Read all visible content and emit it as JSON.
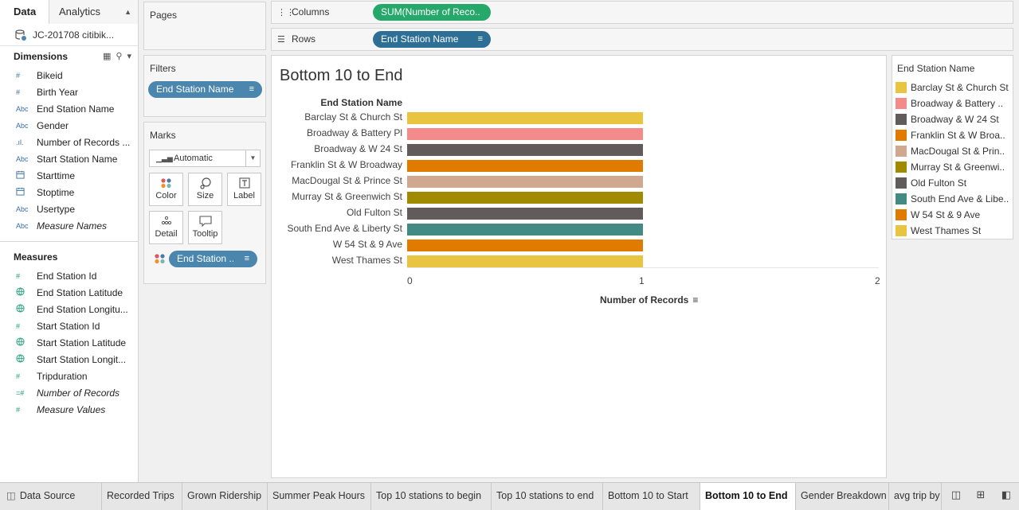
{
  "data_pane": {
    "tabs": {
      "data": "Data",
      "analytics": "Analytics"
    },
    "data_source": "JC-201708 citibik...",
    "dimensions_header": "Dimensions",
    "dimensions": [
      {
        "icon": "#",
        "name": "Bikeid"
      },
      {
        "icon": "#",
        "name": "Birth Year"
      },
      {
        "icon": "Abc",
        "name": "End Station Name"
      },
      {
        "icon": "Abc",
        "name": "Gender"
      },
      {
        "icon": ".ıl.",
        "name": "Number of Records ..."
      },
      {
        "icon": "Abc",
        "name": "Start Station Name"
      },
      {
        "icon": "cal",
        "name": "Starttime"
      },
      {
        "icon": "cal",
        "name": "Stoptime"
      },
      {
        "icon": "Abc",
        "name": "Usertype"
      },
      {
        "icon": "Abc",
        "name": "Measure Names",
        "italic": true
      }
    ],
    "measures_header": "Measures",
    "measures": [
      {
        "icon": "#",
        "name": "End Station Id"
      },
      {
        "icon": "globe",
        "name": "End Station Latitude"
      },
      {
        "icon": "globe",
        "name": "End Station Longitu..."
      },
      {
        "icon": "#",
        "name": "Start Station Id"
      },
      {
        "icon": "globe",
        "name": "Start Station Latitude"
      },
      {
        "icon": "globe",
        "name": "Start Station Longit..."
      },
      {
        "icon": "#",
        "name": "Tripduration"
      },
      {
        "icon": "=#",
        "name": "Number of Records",
        "italic": true
      },
      {
        "icon": "#",
        "name": "Measure Values",
        "italic": true
      }
    ]
  },
  "cards": {
    "pages": "Pages",
    "filters": "Filters",
    "filter_pill": "End Station Name",
    "marks": "Marks",
    "mark_type": "Automatic",
    "mark_buttons": {
      "color": "Color",
      "size": "Size",
      "label": "Label",
      "detail": "Detail",
      "tooltip": "Tooltip"
    },
    "color_pill": "End Station .."
  },
  "shelves": {
    "columns_label": "Columns",
    "columns_pill": "SUM(Number of Reco..",
    "rows_label": "Rows",
    "rows_pill": "End Station Name"
  },
  "view": {
    "title": "Bottom 10 to End"
  },
  "chart_data": {
    "type": "bar",
    "orientation": "horizontal",
    "title": "Bottom 10 to End",
    "ylabel": "End Station Name",
    "xlabel": "Number of Records",
    "categories": [
      "Barclay St & Church St",
      "Broadway & Battery Pl",
      "Broadway & W 24 St",
      "Franklin St & W Broadway",
      "MacDougal St & Prince St",
      "Murray St & Greenwich St",
      "Old Fulton St",
      "South End Ave & Liberty St",
      "W 54 St & 9 Ave",
      "West Thames St"
    ],
    "values": [
      1,
      1,
      1,
      1,
      1,
      1,
      1,
      1,
      1,
      1
    ],
    "colors": [
      "#e9c440",
      "#f28b89",
      "#625b5b",
      "#e07b00",
      "#cfa88f",
      "#a08b00",
      "#625b5b",
      "#438a85",
      "#e07b00",
      "#e9c440"
    ],
    "xlim": [
      0,
      2
    ],
    "xticks": [
      "0",
      "1",
      "2"
    ],
    "grid": false
  },
  "legend": {
    "title": "End Station Name",
    "items": [
      {
        "label": "Barclay St & Church St",
        "color": "#e9c440"
      },
      {
        "label": "Broadway & Battery ..",
        "color": "#f28b89"
      },
      {
        "label": "Broadway & W 24 St",
        "color": "#625b5b"
      },
      {
        "label": "Franklin St & W Broa..",
        "color": "#e07b00"
      },
      {
        "label": "MacDougal St & Prin..",
        "color": "#cfa88f"
      },
      {
        "label": "Murray St & Greenwi..",
        "color": "#a08b00"
      },
      {
        "label": "Old Fulton St",
        "color": "#625b5b"
      },
      {
        "label": "South End Ave & Libe..",
        "color": "#438a85"
      },
      {
        "label": "W 54 St & 9 Ave",
        "color": "#e07b00"
      },
      {
        "label": "West Thames St",
        "color": "#e9c440"
      }
    ]
  },
  "sheet_tabs": [
    {
      "label": "Data Source",
      "active": false
    },
    {
      "label": "Recorded Trips",
      "active": false
    },
    {
      "label": "Grown Ridership",
      "active": false
    },
    {
      "label": "Summer Peak Hours",
      "active": false
    },
    {
      "label": "Top 10 stations to begin",
      "active": false
    },
    {
      "label": "Top 10 stations to end",
      "active": false
    },
    {
      "label": "Bottom 10 to Start",
      "active": false
    },
    {
      "label": "Bottom 10 to End",
      "active": true
    },
    {
      "label": "Gender Breakdown",
      "active": false
    },
    {
      "label": "avg trip by",
      "active": false
    }
  ],
  "colors": {
    "dimension_pill": "#4a86ad",
    "measure_pill": "#27a86b"
  }
}
